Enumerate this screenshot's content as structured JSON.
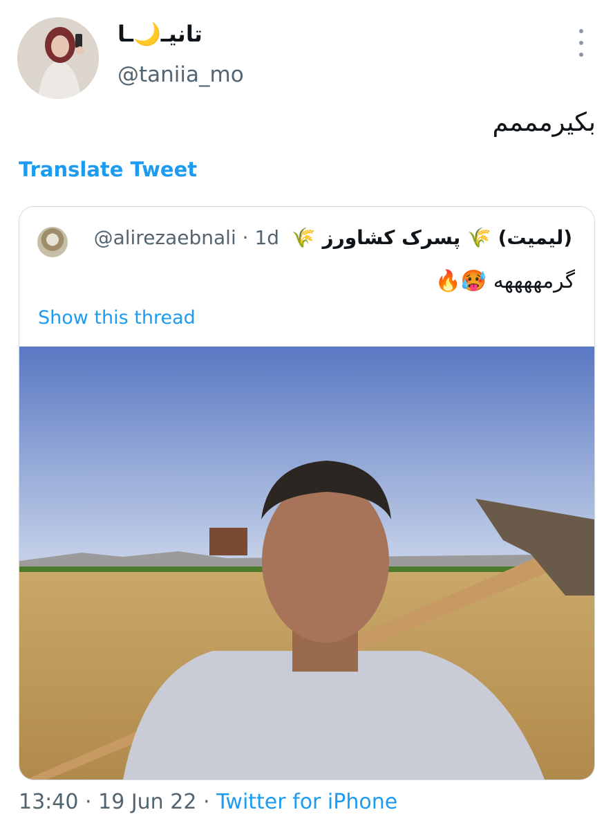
{
  "author": {
    "display_name": "تانیـ🌙ـا",
    "handle": "@taniia_mo"
  },
  "tweet": {
    "text": "بکیرمممم",
    "translate_label": "Translate Tweet"
  },
  "quoted_tweet": {
    "display_name": "(لیمیت) 🌾 پسرک کشاورز 🌾",
    "handle": "@alirezaebnali",
    "separator": "·",
    "time": "1d",
    "text": "گرمههههه 🥵🔥",
    "show_thread_label": "Show this thread"
  },
  "meta": {
    "time": "13:40",
    "dot1": "·",
    "date": "19 Jun 22",
    "dot2": "·",
    "source": "Twitter for iPhone"
  },
  "icons": {
    "more": "more-vertical-icon"
  },
  "colors": {
    "link": "#1d9bf0",
    "secondary": "#536471",
    "border": "#cfd9de"
  }
}
